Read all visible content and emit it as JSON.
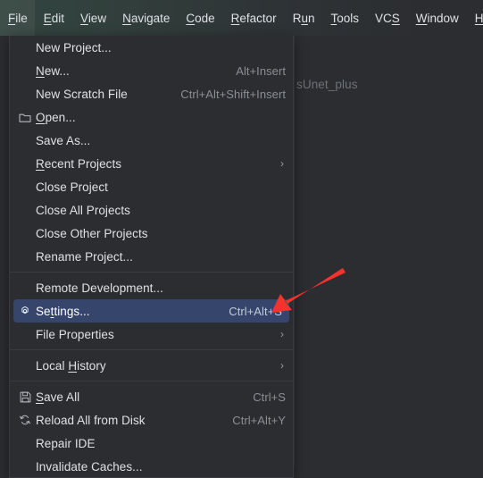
{
  "menubar": {
    "items": [
      {
        "label": "File",
        "mnemonic": "F",
        "selected": true
      },
      {
        "label": "Edit",
        "mnemonic": "E",
        "selected": false
      },
      {
        "label": "View",
        "mnemonic": "V",
        "selected": false
      },
      {
        "label": "Navigate",
        "mnemonic": "N",
        "selected": false
      },
      {
        "label": "Code",
        "mnemonic": "C",
        "selected": false
      },
      {
        "label": "Refactor",
        "mnemonic": "R",
        "selected": false
      },
      {
        "label": "Run",
        "mnemonic": "u",
        "selected": false
      },
      {
        "label": "Tools",
        "mnemonic": "T",
        "selected": false
      },
      {
        "label": "VCS",
        "mnemonic": "S",
        "selected": false
      },
      {
        "label": "Window",
        "mnemonic": "W",
        "selected": false
      },
      {
        "label": "Help",
        "mnemonic": "H",
        "selected": false
      }
    ]
  },
  "editor": {
    "ghost_text": "sUnet_plus"
  },
  "file_menu": {
    "rows": [
      {
        "type": "item",
        "label": "New Project...",
        "icon": "none",
        "shortcut": "",
        "submenu": false,
        "selected": false
      },
      {
        "type": "item",
        "label": "New...",
        "mnemonic": "N",
        "icon": "none",
        "shortcut": "Alt+Insert",
        "submenu": false,
        "selected": false
      },
      {
        "type": "item",
        "label": "New Scratch File",
        "icon": "none",
        "shortcut": "Ctrl+Alt+Shift+Insert",
        "submenu": false,
        "selected": false
      },
      {
        "type": "item",
        "label": "Open...",
        "mnemonic": "O",
        "icon": "folder-icon",
        "shortcut": "",
        "submenu": false,
        "selected": false
      },
      {
        "type": "item",
        "label": "Save As...",
        "icon": "none",
        "shortcut": "",
        "submenu": false,
        "selected": false
      },
      {
        "type": "item",
        "label": "Recent Projects",
        "mnemonic": "R",
        "icon": "none",
        "shortcut": "",
        "submenu": true,
        "selected": false
      },
      {
        "type": "item",
        "label": "Close Project",
        "icon": "none",
        "shortcut": "",
        "submenu": false,
        "selected": false
      },
      {
        "type": "item",
        "label": "Close All Projects",
        "icon": "none",
        "shortcut": "",
        "submenu": false,
        "selected": false
      },
      {
        "type": "item",
        "label": "Close Other Projects",
        "icon": "none",
        "shortcut": "",
        "submenu": false,
        "selected": false
      },
      {
        "type": "item",
        "label": "Rename Project...",
        "icon": "none",
        "shortcut": "",
        "submenu": false,
        "selected": false
      },
      {
        "type": "separator"
      },
      {
        "type": "item",
        "label": "Remote Development...",
        "icon": "none",
        "shortcut": "",
        "submenu": false,
        "selected": false
      },
      {
        "type": "item",
        "label": "Settings...",
        "mnemonic": "t",
        "icon": "gear-icon",
        "shortcut": "Ctrl+Alt+S",
        "submenu": false,
        "selected": true
      },
      {
        "type": "item",
        "label": "File Properties",
        "icon": "none",
        "shortcut": "",
        "submenu": true,
        "selected": false
      },
      {
        "type": "separator"
      },
      {
        "type": "item",
        "label": "Local History",
        "mnemonic": "H",
        "icon": "none",
        "shortcut": "",
        "submenu": true,
        "selected": false
      },
      {
        "type": "separator"
      },
      {
        "type": "item",
        "label": "Save All",
        "mnemonic": "S",
        "icon": "save-icon",
        "shortcut": "Ctrl+S",
        "submenu": false,
        "selected": false
      },
      {
        "type": "item",
        "label": "Reload All from Disk",
        "icon": "reload-icon",
        "shortcut": "Ctrl+Alt+Y",
        "submenu": false,
        "selected": false
      },
      {
        "type": "item",
        "label": "Repair IDE",
        "icon": "none",
        "shortcut": "",
        "submenu": false,
        "selected": false
      },
      {
        "type": "item",
        "label": "Invalidate Caches...",
        "icon": "none",
        "shortcut": "",
        "submenu": false,
        "selected": false
      }
    ]
  },
  "annotation": {
    "type": "arrow",
    "color": "#f5332e",
    "points_to": "Settings..."
  },
  "colors": {
    "menu_background": "#2b2d30",
    "menubar_tint": "#33443f",
    "selection_blue": "#35456b",
    "border": "#393b40",
    "text": "#dfe1e5",
    "shortcut_text": "#8b8e93",
    "annotation_red": "#f5332e"
  }
}
